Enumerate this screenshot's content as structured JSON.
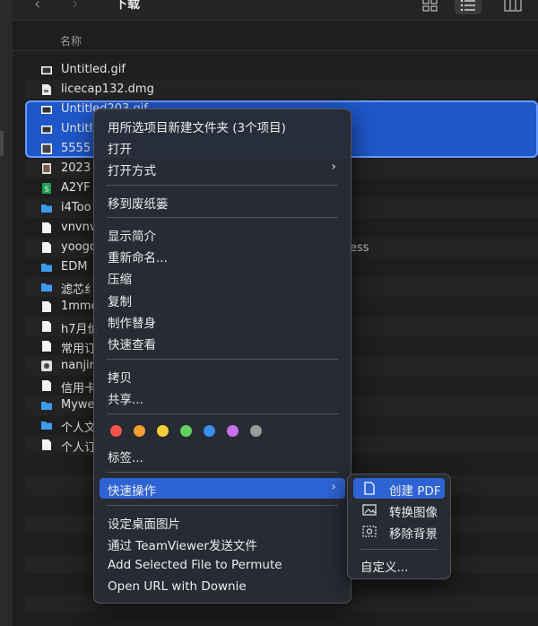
{
  "window": {
    "title": "下载",
    "nav_back": "‹",
    "nav_forward": "›",
    "column_name": "名称"
  },
  "files": [
    {
      "name": "Untitled.gif",
      "icon": "gif-file-icon"
    },
    {
      "name": "licecap132.dmg",
      "icon": "disk-image-icon"
    },
    {
      "name": "Untitled203.gif",
      "icon": "gif-file-icon"
    },
    {
      "name": "Untitl",
      "icon": "gif-file-icon"
    },
    {
      "name": "5555",
      "icon": "image-file-icon"
    },
    {
      "name": "2023",
      "icon": "photo-file-icon"
    },
    {
      "name": "A2YF",
      "icon": "spreadsheet-file-icon"
    },
    {
      "name": "i4Too",
      "icon": "folder-icon"
    },
    {
      "name": "vnvnv",
      "icon": "document-file-icon"
    },
    {
      "name": "yoogo",
      "icon": "document-file-icon"
    },
    {
      "name": "EDM",
      "icon": "folder-icon"
    },
    {
      "name": "滤芯纟",
      "icon": "folder-icon"
    },
    {
      "name": "1mmo",
      "icon": "document-file-icon"
    },
    {
      "name": "h7月价",
      "icon": "document-file-icon"
    },
    {
      "name": "常用订",
      "icon": "document-file-icon"
    },
    {
      "name": "nanjir",
      "icon": "media-file-icon"
    },
    {
      "name": "信用卡",
      "icon": "document-file-icon"
    },
    {
      "name": "Mywe",
      "icon": "folder-icon"
    },
    {
      "name": "个人文",
      "icon": "folder-icon"
    },
    {
      "name": "个人订",
      "icon": "document-file-icon"
    }
  ],
  "partial_text": "ess",
  "context_menu": {
    "new_folder_with_selection": "用所选项目新建文件夹 (3个项目)",
    "open": "打开",
    "open_with": "打开方式",
    "move_to_trash": "移到废纸篓",
    "get_info": "显示简介",
    "rename": "重新命名...",
    "compress": "压缩",
    "duplicate": "复制",
    "make_alias": "制作替身",
    "quick_look": "快速查看",
    "copy": "拷贝",
    "share": "共享...",
    "tag_colors": [
      "#f0544c",
      "#f5a033",
      "#f7d038",
      "#5fd05f",
      "#3a8fea",
      "#c86ff0",
      "#9a9a9a"
    ],
    "tags": "标签...",
    "quick_actions": "快速操作",
    "set_desktop_picture": "设定桌面图片",
    "send_via_teamviewer": "通过 TeamViewer发送文件",
    "add_to_permute": "Add Selected File to Permute",
    "open_url_downie": "Open URL with Downie",
    "submenu_chevron": "›"
  },
  "quick_actions_menu": {
    "create_pdf": "创建 PDF",
    "convert_image": "转换图像",
    "remove_background": "移除背景",
    "customize": "自定义..."
  },
  "colors": {
    "selection": "#1f57c9",
    "highlight": "#2e63d4",
    "menu_bg": "#282c34"
  }
}
